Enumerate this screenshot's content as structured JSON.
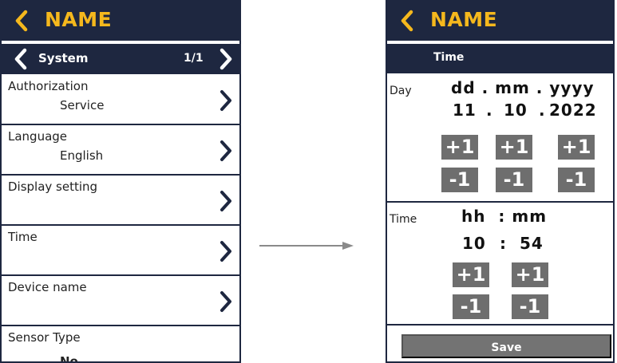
{
  "left": {
    "header": {
      "title": "NAME"
    },
    "subheader": {
      "title": "System",
      "page": "1/1"
    },
    "menu": [
      {
        "label": "Authorization",
        "value": "Service"
      },
      {
        "label": "Language",
        "value": "English"
      },
      {
        "label": "Display setting",
        "value": ""
      },
      {
        "label": "Time",
        "value": ""
      },
      {
        "label": "Device name",
        "value": ""
      },
      {
        "label": "Sensor Type",
        "value": "No"
      }
    ]
  },
  "right": {
    "header": {
      "title": "NAME"
    },
    "subheader": {
      "title": "Time"
    },
    "date": {
      "label": "Day",
      "format": "dd . mm . yyyy",
      "day": "11",
      "month": "10",
      "year": "2022",
      "sep": "."
    },
    "time": {
      "label": "Time",
      "format": "hh  : mm",
      "hour": "10",
      "minute": "54",
      "sep": ":"
    },
    "buttons": {
      "plus": "+1",
      "minus": "-1"
    },
    "save_label": "Save"
  },
  "colors": {
    "header_bg": "#1e2740",
    "title_accent": "#f5b81d",
    "button_bg": "#6e6e6e"
  }
}
